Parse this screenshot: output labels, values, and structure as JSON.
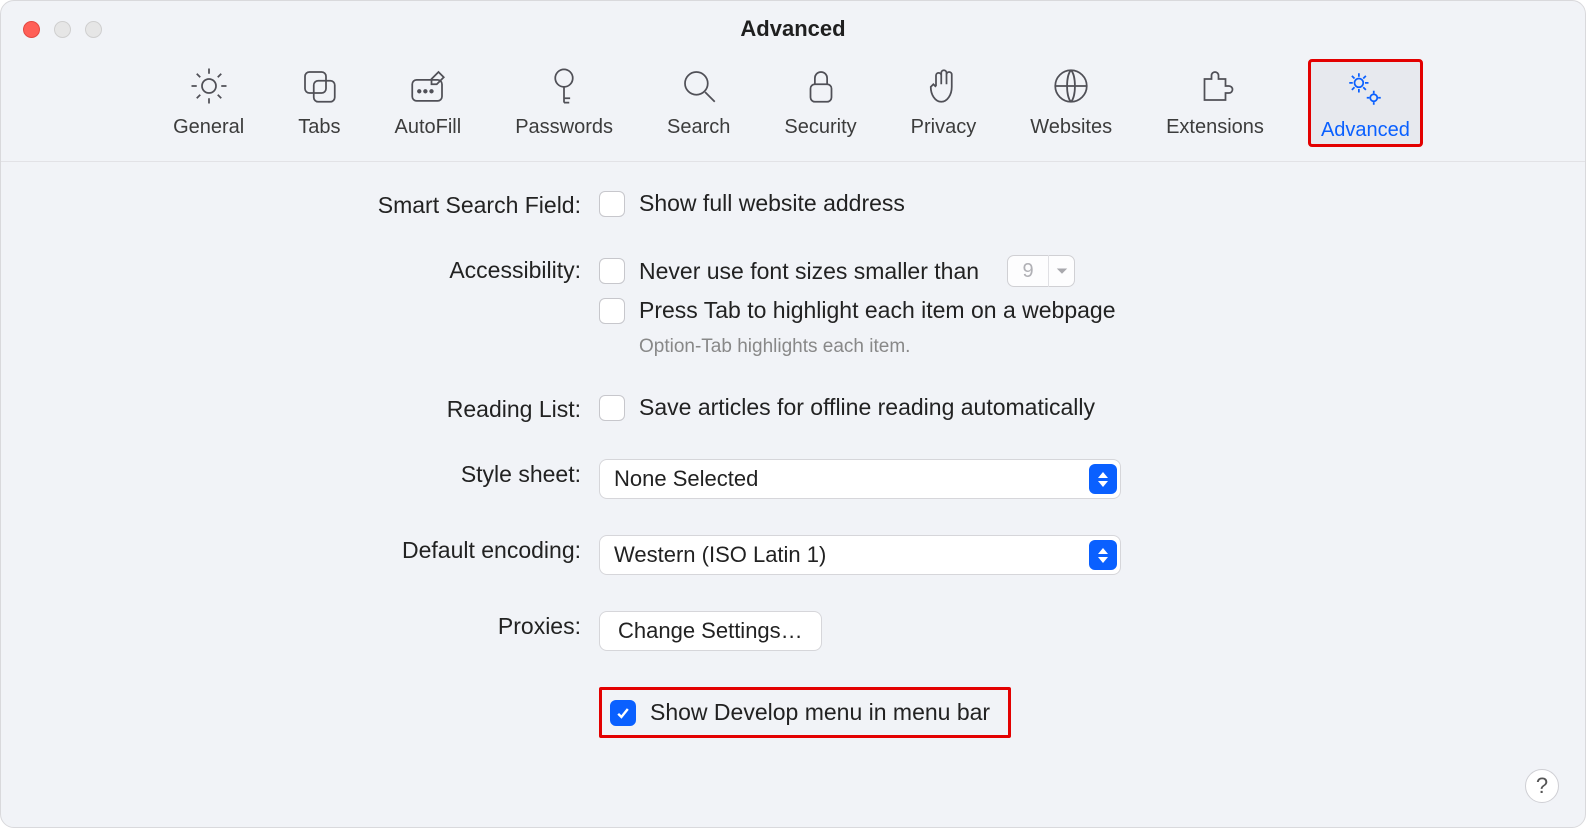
{
  "window": {
    "title": "Advanced"
  },
  "tabs": [
    {
      "id": "general",
      "label": "General"
    },
    {
      "id": "tabs",
      "label": "Tabs"
    },
    {
      "id": "autofill",
      "label": "AutoFill"
    },
    {
      "id": "passwords",
      "label": "Passwords"
    },
    {
      "id": "search",
      "label": "Search"
    },
    {
      "id": "security",
      "label": "Security"
    },
    {
      "id": "privacy",
      "label": "Privacy"
    },
    {
      "id": "websites",
      "label": "Websites"
    },
    {
      "id": "extensions",
      "label": "Extensions"
    },
    {
      "id": "advanced",
      "label": "Advanced"
    }
  ],
  "sections": {
    "smart_search": {
      "label": "Smart Search Field:",
      "show_full_address": "Show full website address"
    },
    "accessibility": {
      "label": "Accessibility:",
      "never_smaller": "Never use font sizes smaller than",
      "font_size": "9",
      "press_tab": "Press Tab to highlight each item on a webpage",
      "hint": "Option-Tab highlights each item."
    },
    "reading_list": {
      "label": "Reading List:",
      "save_offline": "Save articles for offline reading automatically"
    },
    "style_sheet": {
      "label": "Style sheet:",
      "value": "None Selected"
    },
    "default_encoding": {
      "label": "Default encoding:",
      "value": "Western (ISO Latin 1)"
    },
    "proxies": {
      "label": "Proxies:",
      "button": "Change Settings…"
    },
    "develop": {
      "show_develop": "Show Develop menu in menu bar"
    }
  },
  "help": "?"
}
